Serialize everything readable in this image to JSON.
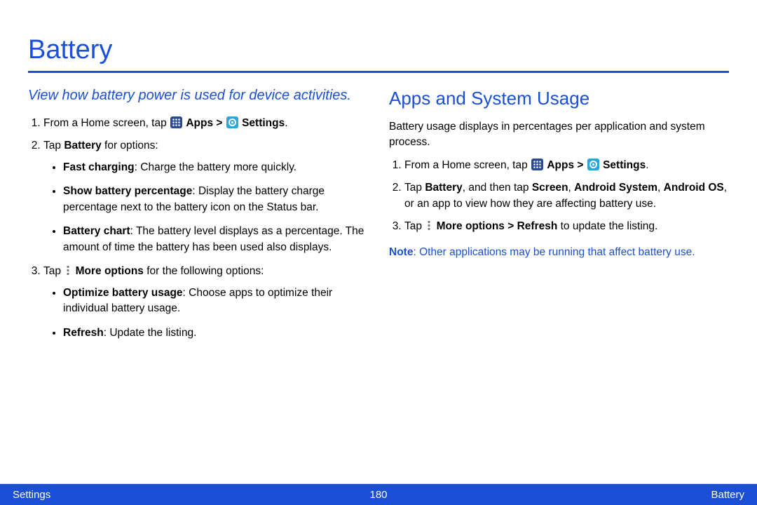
{
  "title": "Battery",
  "left": {
    "intro": "View how battery power is used for device activities.",
    "step1_pre": "From a Home screen, tap ",
    "apps_label": "Apps > ",
    "settings_label": "Settings",
    "step1_post": ".",
    "step2_pre": "Tap ",
    "step2_bold": "Battery",
    "step2_post": " for options:",
    "b1_bold": "Fast charging",
    "b1_rest": ": Charge the battery more quickly.",
    "b2_bold": "Show battery percentage",
    "b2_rest": ": Display the battery charge percentage next to the battery icon on the Status bar.",
    "b3_bold": "Battery chart",
    "b3_rest": ": The battery level displays as a percentage. The amount of time the battery has been used also displays.",
    "step3_pre": "Tap ",
    "step3_bold": "More options",
    "step3_post": " for the following options:",
    "b4_bold": "Optimize battery usage",
    "b4_rest": ": Choose apps to optimize their individual battery usage.",
    "b5_bold": "Refresh",
    "b5_rest": ": Update the listing."
  },
  "right": {
    "heading": "Apps and System Usage",
    "p1": "Battery usage displays in percentages per application and system process.",
    "step1_pre": "From a Home screen, tap ",
    "apps_label": "Apps > ",
    "settings_label": "Settings",
    "step1_post": ".",
    "step2_pre": "Tap ",
    "step2_b1": "Battery",
    "step2_mid1": ", and then tap ",
    "step2_b2": "Screen",
    "step2_mid2": ", ",
    "step2_b3": "Android System",
    "step2_mid3": ", ",
    "step2_b4": "Android OS",
    "step2_post": ", or an app to view how they are affecting battery use.",
    "step3_pre": "Tap ",
    "step3_bold": "More options > Refresh",
    "step3_post": " to update the listing.",
    "note_bold": "Note",
    "note_rest": ": Other applications may be running that affect battery use."
  },
  "footer": {
    "left": "Settings",
    "center": "180",
    "right": "Battery"
  }
}
